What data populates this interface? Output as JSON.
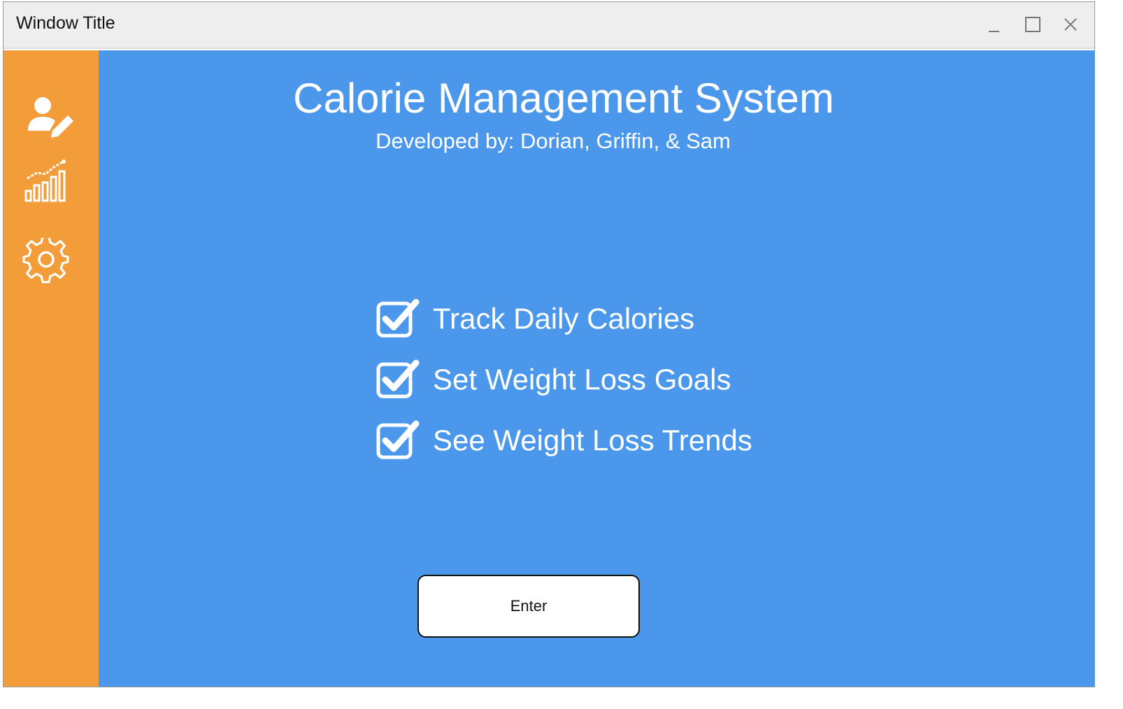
{
  "window": {
    "title": "Window Title"
  },
  "sidebar": {
    "items": [
      {
        "icon": "user-edit-icon"
      },
      {
        "icon": "chart-icon"
      },
      {
        "icon": "gear-icon"
      }
    ]
  },
  "main": {
    "title": "Calorie Management System",
    "subtitle": "Developed by: Dorian, Griffin, & Sam",
    "features": [
      {
        "label": "Track Daily Calories",
        "checked": true
      },
      {
        "label": "Set Weight Loss Goals",
        "checked": true
      },
      {
        "label": "See Weight Loss Trends",
        "checked": true
      }
    ],
    "enter_label": "Enter"
  },
  "colors": {
    "sidebar": "#f29d3a",
    "main": "#4a97eb",
    "titlebar": "#eeeeee"
  }
}
